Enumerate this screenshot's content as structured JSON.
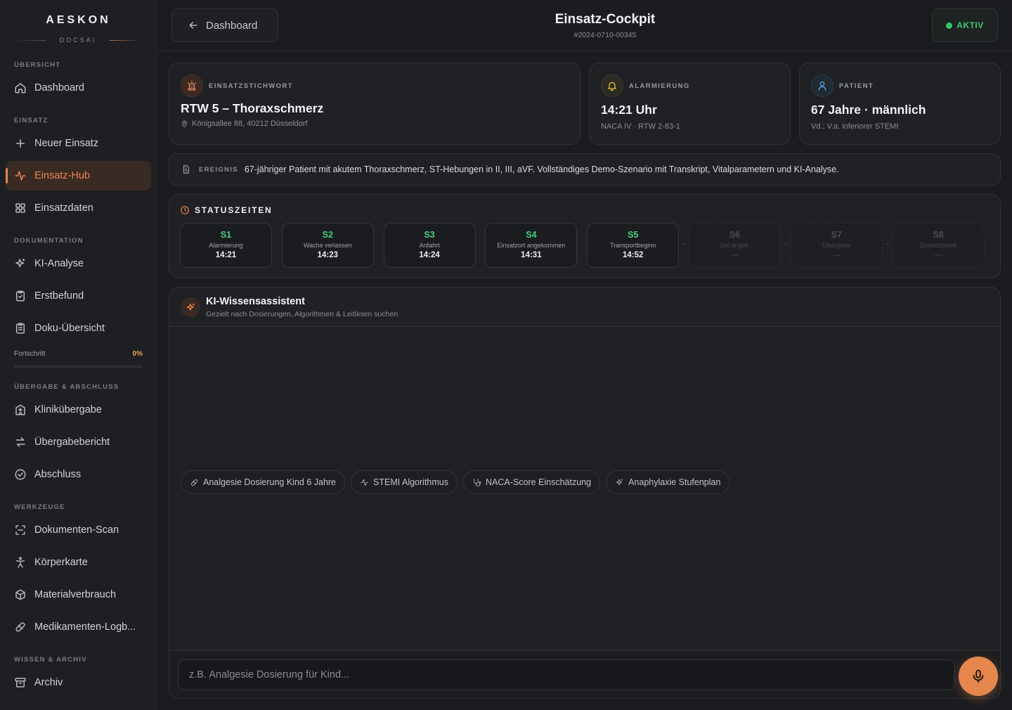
{
  "brand": {
    "name": "AESKON",
    "sub": "DOCSAI"
  },
  "sidebar": {
    "sections": {
      "overview": "ÜBERSICHT",
      "mission": "EINSATZ",
      "documentation": "DOKUMENTATION",
      "handover": "ÜBERGABE & ABSCHLUSS",
      "tools": "WERKZEUGE",
      "knowledge": "WISSEN & ARCHIV"
    },
    "items": {
      "dashboard": "Dashboard",
      "new_mission": "Neuer Einsatz",
      "hub": "Einsatz-Hub",
      "mission_data": "Einsatzdaten",
      "ai_analysis": "KI-Analyse",
      "initial_finding": "Erstbefund",
      "doc_overview": "Doku-Übersicht",
      "clinic_handover": "Klinikübergabe",
      "handover_report": "Übergabebericht",
      "completion": "Abschluss",
      "doc_scan": "Dokumenten-Scan",
      "body_map": "Körperkarte",
      "material": "Materialverbrauch",
      "med_log": "Medikamenten-Logb...",
      "archive": "Archiv"
    },
    "progress": {
      "label": "Fortschritt",
      "value_text": "0%",
      "value": 0
    }
  },
  "header": {
    "back_label": "Dashboard",
    "title": "Einsatz-Cockpit",
    "mission_id": "#2024-0710-00345",
    "status": "AKTIV"
  },
  "cards": {
    "keyword": {
      "label": "EINSATZSTICHWORT",
      "value": "RTW 5 – Thoraxschmerz",
      "meta": "Königsallee 88, 40212 Düsseldorf"
    },
    "alarm": {
      "label": "ALARMIERUNG",
      "value": "14:21 Uhr",
      "meta": "NACA IV · RTW 2-83-1"
    },
    "patient": {
      "label": "PATIENT",
      "value": "67 Jahre · männlich",
      "meta": "Vd.: V.a. inferiorer STEMI"
    }
  },
  "event": {
    "label": "EREIGNIS",
    "text": "67-jähriger Patient mit akutem Thoraxschmerz, ST-Hebungen in II, III, aVF. Vollständiges Demo-Szenario mit Transkript, Vitalparametern und KI-Analyse."
  },
  "status_times": {
    "title": "STATUSZEITEN",
    "items": [
      {
        "code": "S1",
        "desc": "Alarmierung",
        "time": "14:21"
      },
      {
        "code": "S2",
        "desc": "Wache verlassen",
        "time": "14:23"
      },
      {
        "code": "S3",
        "desc": "Anfahrt",
        "time": "14:24"
      },
      {
        "code": "S4",
        "desc": "Einsatzort angekommen",
        "time": "14:31"
      },
      {
        "code": "S5",
        "desc": "Transportbeginn",
        "time": "14:52"
      },
      {
        "code": "S6",
        "desc": "Ziel angek.",
        "time": "—"
      },
      {
        "code": "S7",
        "desc": "Übergabe",
        "time": "—"
      },
      {
        "code": "S8",
        "desc": "Einsatzbereit",
        "time": "—"
      }
    ]
  },
  "assistant": {
    "title": "KI-Wissensassistent",
    "subtitle": "Gezielt nach Dosierungen, Algorithmen & Leitlinien suchen",
    "chips": [
      "Analgesie Dosierung Kind 6 Jahre",
      "STEMI Algorithmus",
      "NACA-Score Einschätzung",
      "Anaphylaxie Stufenplan"
    ],
    "input_placeholder": "z.B. Analgesie Dosierung für Kind..."
  },
  "colors": {
    "accent": "#e9864c",
    "active_bg": "#3a2a24",
    "status_green": "#3fd37c",
    "alarm_yellow": "#e3b43b",
    "patient_blue": "#5aa7e6"
  }
}
